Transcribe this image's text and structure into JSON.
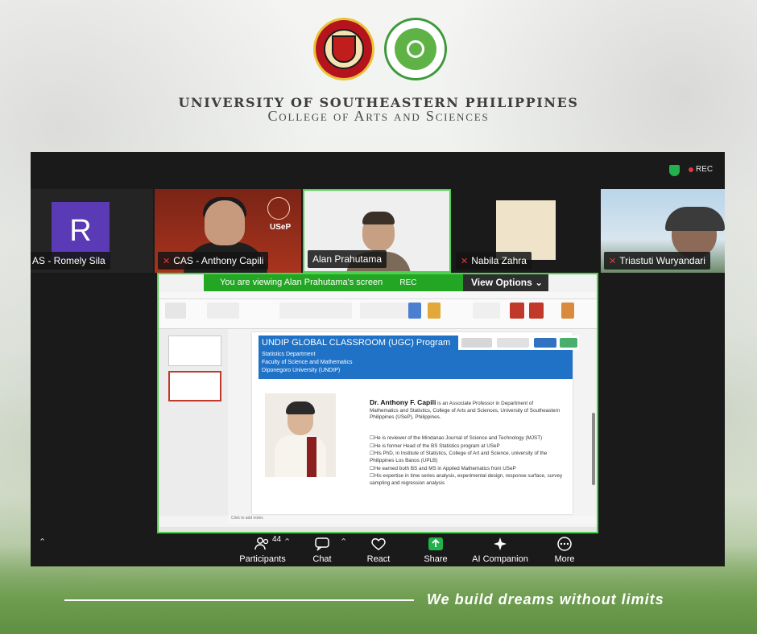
{
  "header": {
    "university": "UNIVERSITY OF SOUTHEASTERN PHILIPPINES",
    "college": "College of Arts and Sciences"
  },
  "meeting": {
    "rec_label": "REC",
    "participants": [
      {
        "name": "AS - Romely Sila",
        "avatar_letter": "R",
        "muted": false,
        "avatar_color": "#5b3bb5"
      },
      {
        "name": "CAS - Anthony Capili",
        "muted": true,
        "tile_logo_text": "USeP"
      },
      {
        "name": "Alan Prahutama",
        "muted": false,
        "active_speaker": true
      },
      {
        "name": "Nabila Zahra",
        "muted": true
      },
      {
        "name": "Triastuti Wuryandari",
        "muted": true
      }
    ],
    "share_banner": {
      "viewing_prefix": "You are viewing",
      "viewing_name": "Alan Prahutama's screen",
      "rec": "REC",
      "view_options": "View Options"
    },
    "toolbar": {
      "participants_count": "44",
      "participants_label": "Participants",
      "chat_label": "Chat",
      "react_label": "React",
      "share_label": "Share",
      "ai_label": "AI Companion",
      "more_label": "More"
    },
    "accent": "#23a623"
  },
  "slide": {
    "title": "UNDIP GLOBAL CLASSROOM (UGC) Program",
    "subtitle_1": "Statistics Department",
    "subtitle_2": "Faculty of Science and Mathematics",
    "subtitle_3": "Diponegoro University (UNDIP)",
    "bio_name": "Dr. Anthony F. Capili",
    "bio_text": "is an Associate Professor in Department of Mathematics and Statistics, College of Arts and Sciences, University of Southeastern Philippines (USeP), Philippines.",
    "bullets": [
      "He is reviewer of the Mindanao Journal of Science and Technology (MJST)",
      "He is former Head of the BS Statistics program at USeP",
      "His PhD, in Institute of Statistics, College of Art and Science, university of the Philippines Los Banos (UPLB)",
      "He earned both BS and MS in Applied Mathematics from USeP",
      "His expertise in time series analysis, experimental design, response surface, survey sampling and regression analysis"
    ],
    "notes_placeholder": "Click to add notes",
    "header_color": "#1f72c6"
  },
  "footer": {
    "tagline": "We build dreams without limits"
  }
}
